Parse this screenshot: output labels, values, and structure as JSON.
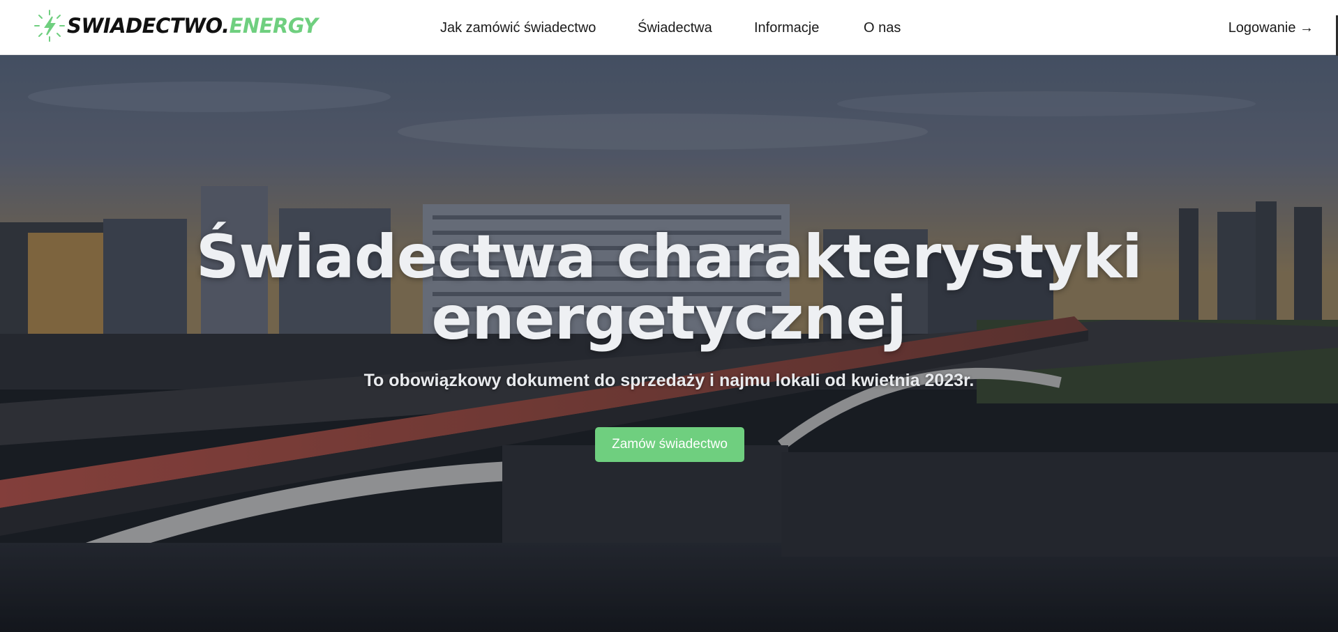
{
  "brand": {
    "name_main": "SWIADECTWO.",
    "name_accent": "ENERGY",
    "icon": "lightning-bolt-icon",
    "accent_color": "#6fcf7f"
  },
  "nav": {
    "items": [
      {
        "label": "Jak zamówić świadectwo"
      },
      {
        "label": "Świadectwa"
      },
      {
        "label": "Informacje"
      },
      {
        "label": "O nas"
      }
    ],
    "login_label": "Logowanie →"
  },
  "hero": {
    "title_line1": "Świadectwa charakterystyki",
    "title_line2": "energetycznej",
    "subtitle": "To obowiązkowy dokument do sprzedaży i najmu lokali od kwietnia 2023r.",
    "cta_label": "Zamów świadectwo",
    "background": "city-bridge-river-photo"
  }
}
